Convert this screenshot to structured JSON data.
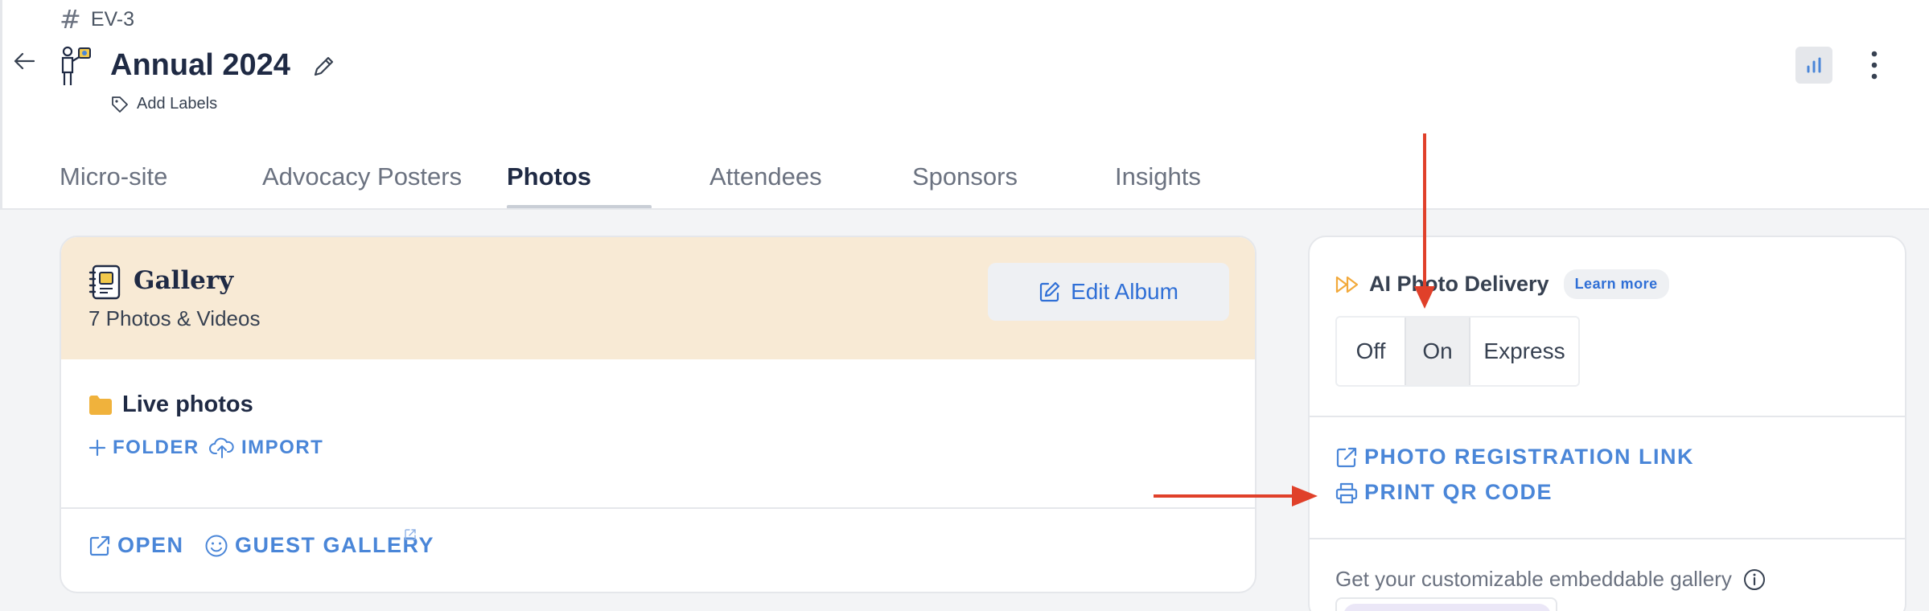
{
  "header": {
    "event_code": "EV-3",
    "event_title": "Annual 2024",
    "add_labels": "Add Labels"
  },
  "tabs": [
    {
      "label": "Micro-site",
      "active": false
    },
    {
      "label": "Advocacy Posters",
      "active": false
    },
    {
      "label": "Photos",
      "active": true
    },
    {
      "label": "Attendees",
      "active": false
    },
    {
      "label": "Sponsors",
      "active": false
    },
    {
      "label": "Insights",
      "active": false
    }
  ],
  "gallery": {
    "title": "Gallery",
    "count": "7 Photos & Videos",
    "edit_album": "Edit Album",
    "folder_name": "Live photos",
    "folder_action": "FOLDER",
    "import_action": "IMPORT",
    "open_action": "OPEN",
    "guest_gallery_action": "GUEST GALLERY"
  },
  "ai_delivery": {
    "title": "AI Photo Delivery",
    "learn_more": "Learn more",
    "options": [
      "Off",
      "On",
      "Express"
    ],
    "selected": "On",
    "registration_link": "PHOTO REGISTRATION LINK",
    "print_qr": "PRINT QR CODE",
    "embed_text": "Get your customizable embeddable gallery"
  },
  "colors": {
    "accent_blue": "#4a86d8",
    "link_blue": "#2f6fd6",
    "title_navy": "#1f2a44",
    "gallery_header_bg": "#f8ead5",
    "folder_yellow": "#f0b23c",
    "ai_icon_orange": "#f2a93b",
    "annotation_red": "#e0402a"
  },
  "icons": {
    "back": "arrow-left-icon",
    "event": "person-easel-icon",
    "edit": "pencil-icon",
    "label": "tag-icon",
    "insights": "bar-chart-icon",
    "more": "vertical-dots-icon",
    "gallery": "notebook-icon",
    "folder": "folder-icon",
    "plus": "plus-icon",
    "import": "cloud-upload-icon",
    "open": "external-link-icon",
    "guest": "smile-icon",
    "ai": "fast-forward-icon",
    "print": "printer-icon",
    "info": "info-icon"
  }
}
